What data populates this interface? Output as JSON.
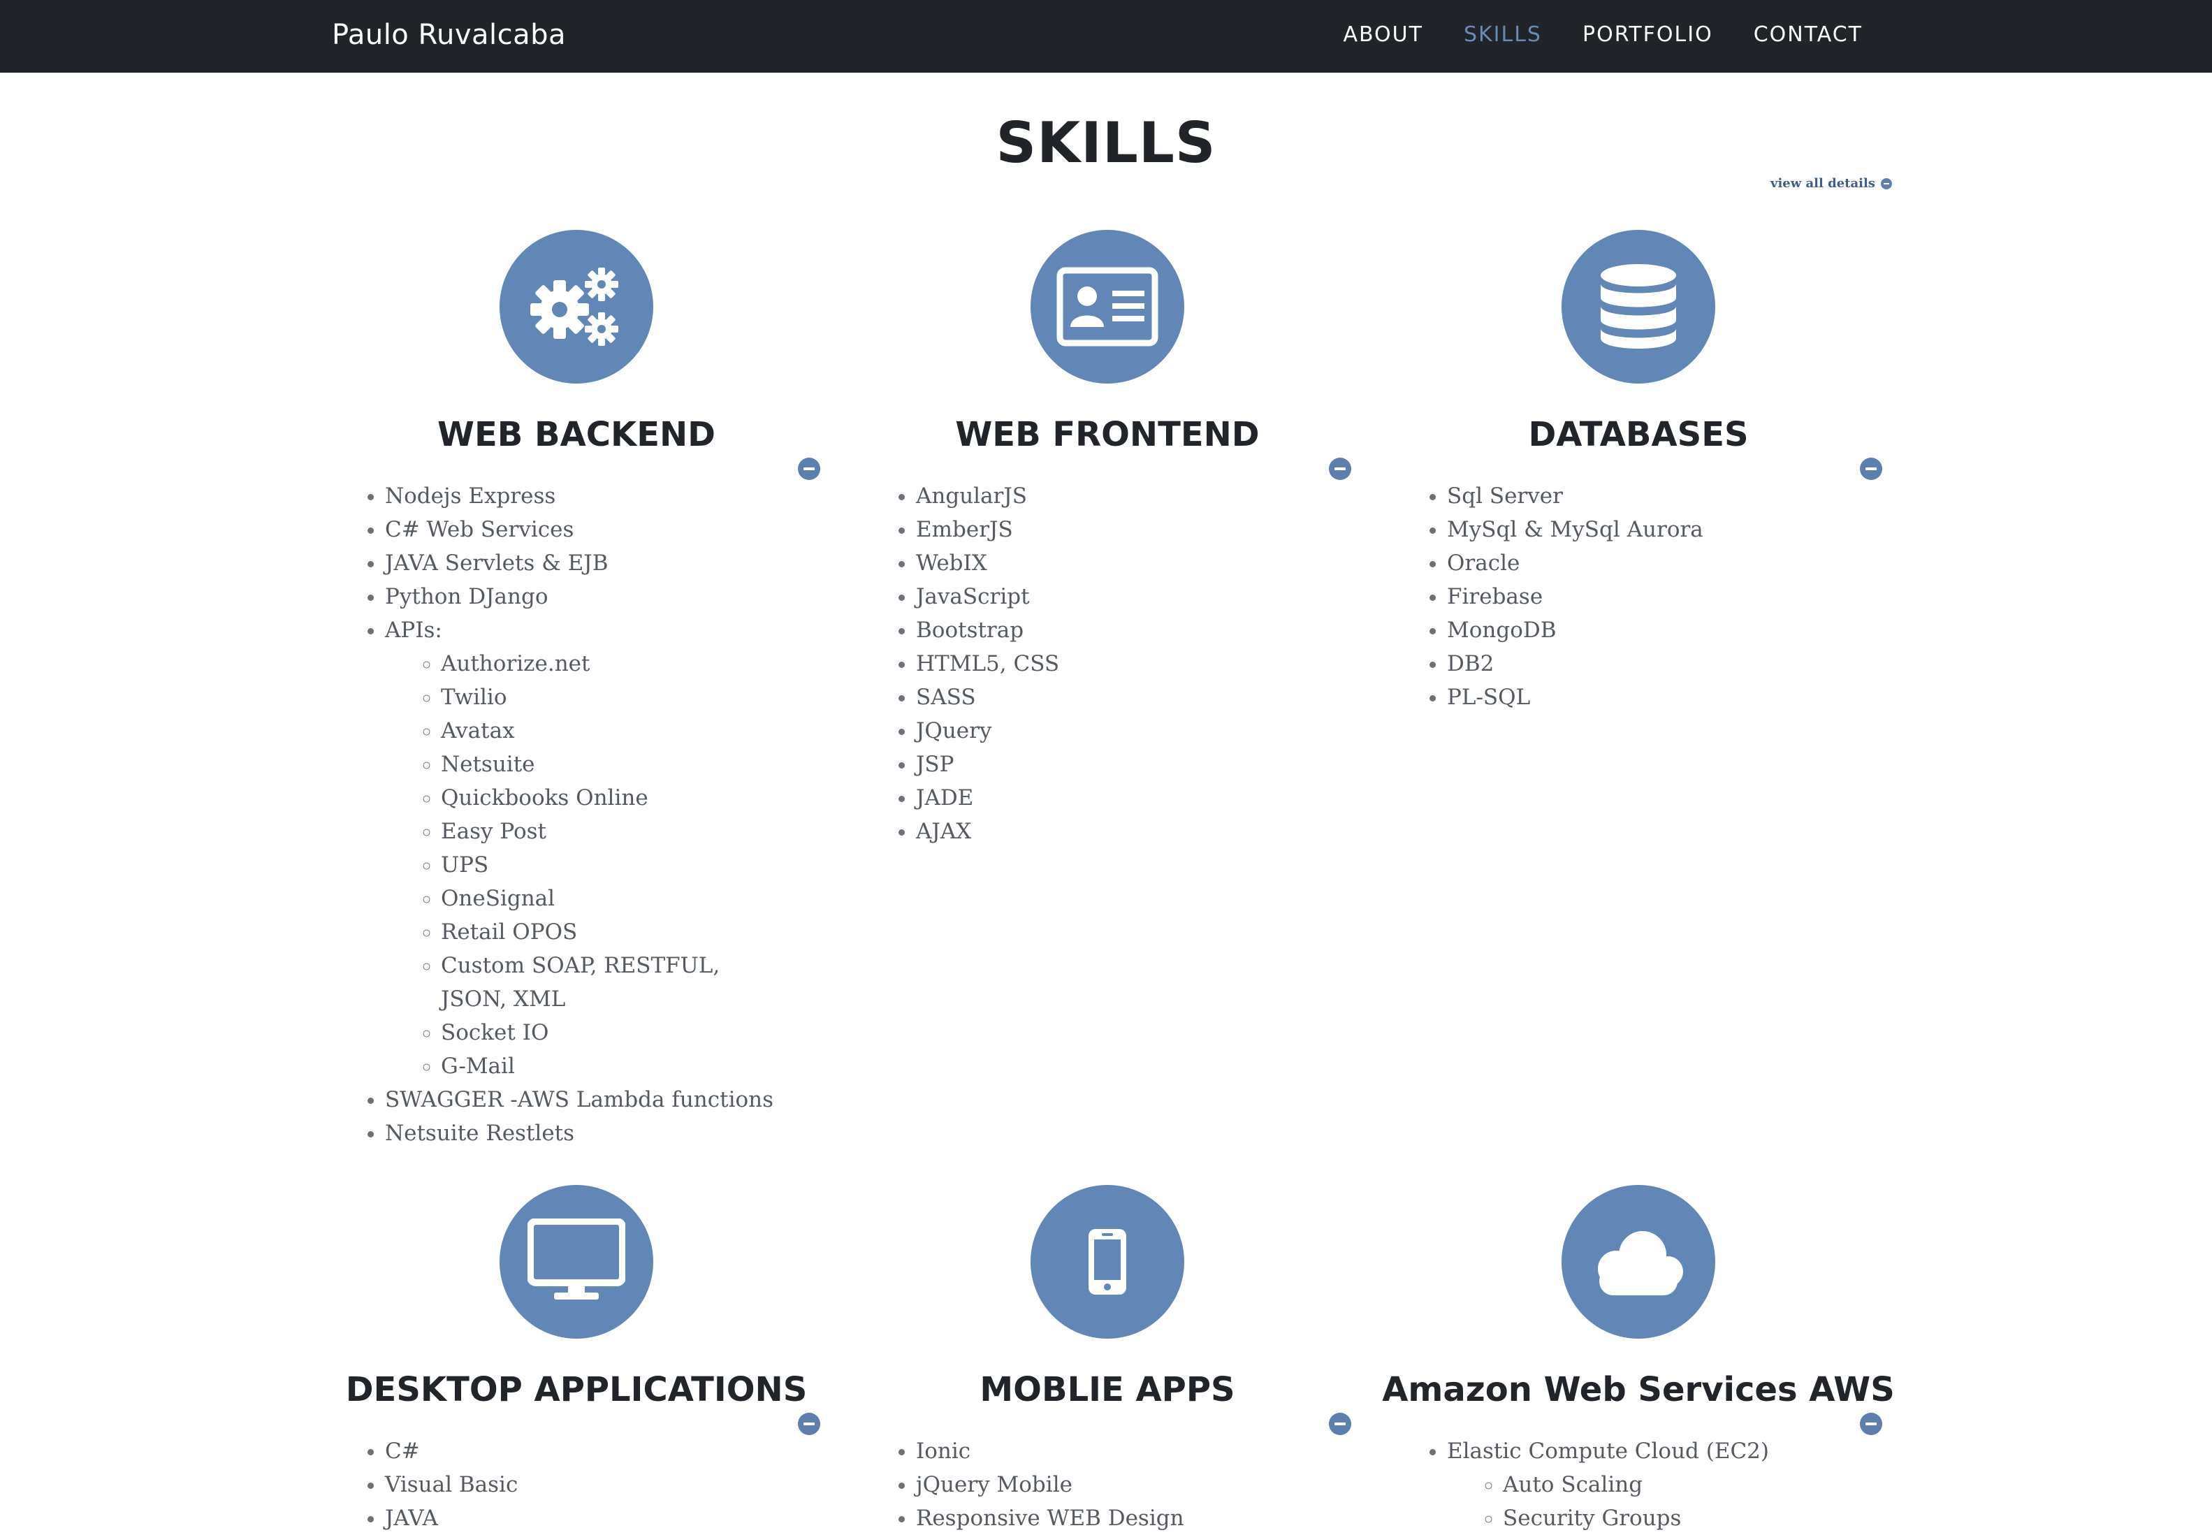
{
  "nav": {
    "brand": "Paulo Ruvalcaba",
    "links": [
      "ABOUT",
      "SKILLS",
      "PORTFOLIO",
      "CONTACT"
    ],
    "active": "SKILLS"
  },
  "page": {
    "title": "SKILLS",
    "view_all": "view all details"
  },
  "colors": {
    "navbar": "#212529",
    "accent": "#6187b6",
    "active_link": "#6a8ab3",
    "text": "#555a60"
  },
  "sections": [
    {
      "icon": "gears-icon",
      "title": "WEB BACKEND",
      "items": [
        {
          "label": "Nodejs Express"
        },
        {
          "label": "C# Web Services"
        },
        {
          "label": "JAVA Servlets & EJB"
        },
        {
          "label": "Python DJango"
        },
        {
          "label": "APIs:",
          "children": [
            "Authorize.net",
            "Twilio",
            "Avatax",
            "Netsuite",
            "Quickbooks Online",
            "Easy Post",
            "UPS",
            "OneSignal",
            "Retail OPOS",
            "Custom SOAP, RESTFUL, JSON, XML",
            "Socket IO",
            "G-Mail"
          ]
        },
        {
          "label": "SWAGGER -AWS Lambda functions"
        },
        {
          "label": "Netsuite Restlets"
        }
      ]
    },
    {
      "icon": "id-card-icon",
      "title": "WEB FRONTEND",
      "items": [
        {
          "label": "AngularJS"
        },
        {
          "label": "EmberJS"
        },
        {
          "label": "WebIX"
        },
        {
          "label": "JavaScript"
        },
        {
          "label": "Bootstrap"
        },
        {
          "label": "HTML5, CSS"
        },
        {
          "label": "SASS"
        },
        {
          "label": "JQuery"
        },
        {
          "label": "JSP"
        },
        {
          "label": "JADE"
        },
        {
          "label": "AJAX"
        }
      ]
    },
    {
      "icon": "database-icon",
      "title": "DATABASES",
      "items": [
        {
          "label": "Sql Server"
        },
        {
          "label": "MySql & MySql Aurora"
        },
        {
          "label": "Oracle"
        },
        {
          "label": "Firebase"
        },
        {
          "label": "MongoDB"
        },
        {
          "label": "DB2"
        },
        {
          "label": "PL-SQL"
        }
      ]
    },
    {
      "icon": "desktop-icon",
      "title": "DESKTOP APPLICATIONS",
      "items": [
        {
          "label": "C#"
        },
        {
          "label": "Visual Basic"
        },
        {
          "label": "JAVA"
        }
      ]
    },
    {
      "icon": "mobile-phone-icon",
      "title": "MOBLIE APPS",
      "items": [
        {
          "label": "Ionic"
        },
        {
          "label": "jQuery Mobile"
        },
        {
          "label": "Responsive WEB Design"
        }
      ]
    },
    {
      "icon": "cloud-icon",
      "title": "Amazon Web Services AWS",
      "items": [
        {
          "label": "Elastic Compute Cloud (EC2)",
          "children": [
            "Auto Scaling",
            "Security Groups"
          ]
        }
      ]
    }
  ]
}
